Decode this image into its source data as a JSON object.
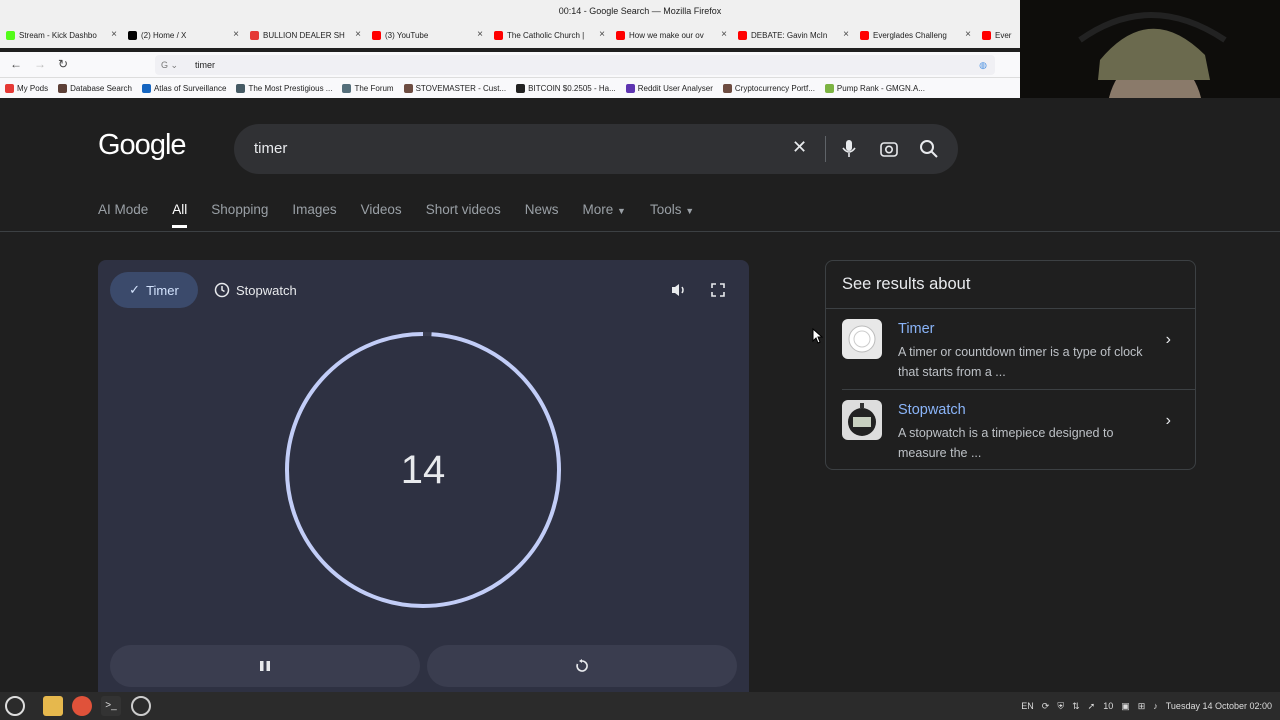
{
  "window": {
    "title": "00:14 - Google Search — Mozilla Firefox"
  },
  "tabs": [
    {
      "label": "Stream - Kick Dashbo",
      "color": "#53fc18"
    },
    {
      "label": "(2) Home / X",
      "color": "#000000"
    },
    {
      "label": "BULLION DEALER SH",
      "color": "#e53935"
    },
    {
      "label": "(3) YouTube",
      "color": "#ff0000"
    },
    {
      "label": "The Catholic Church |",
      "color": "#ff0000"
    },
    {
      "label": "How we make our ov",
      "color": "#ff0000"
    },
    {
      "label": "DEBATE: Gavin McIn",
      "color": "#ff0000"
    },
    {
      "label": "Everglades Challeng",
      "color": "#ff0000"
    },
    {
      "label": "Ever",
      "color": "#ff0000"
    }
  ],
  "urlbar": {
    "value": "timer"
  },
  "bookmarks": [
    {
      "label": "My Pods",
      "color": "#e53935"
    },
    {
      "label": "Database Search",
      "color": "#5d4037"
    },
    {
      "label": "Atlas of Surveillance",
      "color": "#1565c0"
    },
    {
      "label": "The Most Prestigious ...",
      "color": "#455a64"
    },
    {
      "label": "The Forum",
      "color": "#546e7a"
    },
    {
      "label": "STOVEMASTER - Cust...",
      "color": "#6d4c41"
    },
    {
      "label": "BITCOIN $0.2505 - Ha...",
      "color": "#212121"
    },
    {
      "label": "Reddit User Analyser",
      "color": "#5e35b1"
    },
    {
      "label": "Cryptocurrency Portf...",
      "color": "#6d4c41"
    },
    {
      "label": "Pump Rank - GMGN.A...",
      "color": "#7cb342"
    }
  ],
  "google": {
    "logo": "Google",
    "query": "timer",
    "nav": [
      "AI Mode",
      "All",
      "Shopping",
      "Images",
      "Videos",
      "Short videos",
      "News",
      "More",
      "Tools"
    ]
  },
  "timer": {
    "mode_timer": "Timer",
    "mode_stopwatch": "Stopwatch",
    "remaining": "14",
    "progress": 0.99
  },
  "side": {
    "title": "See results about",
    "items": [
      {
        "name": "Timer",
        "desc": "A timer or countdown timer is a type of clock that starts from a ..."
      },
      {
        "name": "Stopwatch",
        "desc": "A stopwatch is a timepiece designed to measure the ..."
      }
    ]
  },
  "taskbar": {
    "lang": "EN",
    "volume_level": "10",
    "clock": "Tuesday 14 October 02:00"
  }
}
